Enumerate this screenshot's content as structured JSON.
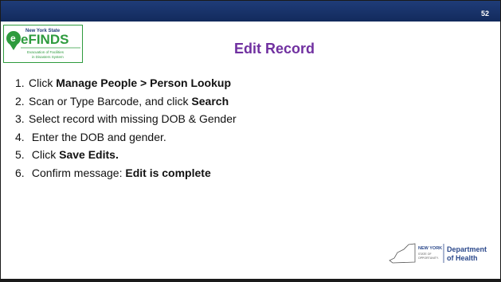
{
  "slide": {
    "number": "52",
    "title": "Edit Record"
  },
  "logo": {
    "top_text": "New York State",
    "name": "eFINDS",
    "subtitle_line1": "Evacuation of Facilities",
    "subtitle_line2": "in Disasters System"
  },
  "steps": [
    {
      "num": "1.",
      "plain": "Click ",
      "bold": "Manage People > Person Lookup",
      "after": ""
    },
    {
      "num": "2.",
      "plain": "Scan or Type Barcode, and click ",
      "bold": "Search",
      "after": ""
    },
    {
      "num": "3.",
      "plain": "Select record with missing DOB & Gender",
      "bold": "",
      "after": ""
    },
    {
      "num": "4.",
      "plain": " Enter the DOB and gender.",
      "bold": "",
      "after": ""
    },
    {
      "num": "5.",
      "plain": " Click ",
      "bold": "Save Edits.",
      "after": ""
    },
    {
      "num": "6.",
      "plain": " Confirm message: ",
      "bold": "Edit is complete",
      "after": ""
    }
  ],
  "footer_logo": {
    "state_line1": "NEW YORK",
    "state_line2": "STATE OF",
    "state_line3": "OPPORTUNITY.",
    "dept_line1": "Department",
    "dept_line2": "of Health"
  },
  "colors": {
    "topbar": "#1f3c78",
    "title": "#7030a0",
    "logo_green": "#2e9b3e",
    "doh_blue": "#2d4a8c"
  }
}
